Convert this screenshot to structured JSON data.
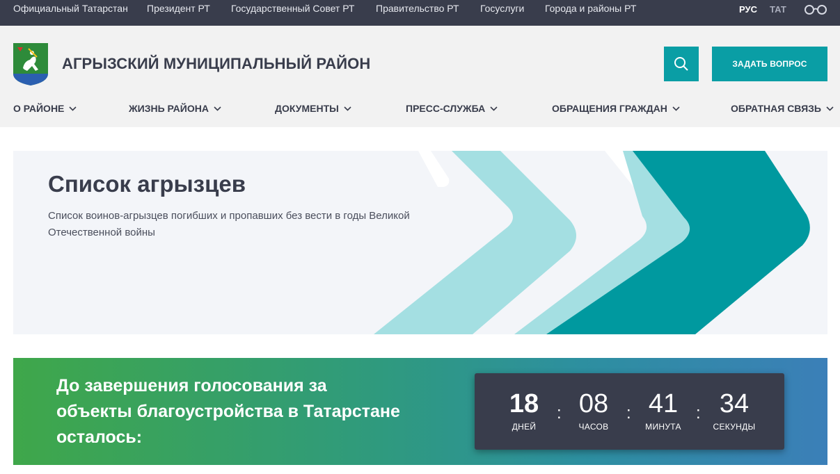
{
  "topbar": {
    "links": [
      "Официальный Татарстан",
      "Президент РТ",
      "Государственный Совет РТ",
      "Правительство РТ",
      "Госуслуги",
      "Города и районы РТ"
    ],
    "lang_ru": "РУС",
    "lang_tat": "ТАТ",
    "accessibility_icon": "glasses-icon"
  },
  "header": {
    "title": "АГРЫЗСКИЙ МУНИЦИПАЛЬНЫЙ РАЙОН",
    "ask_button": "ЗАДАТЬ ВОПРОС",
    "search_icon": "search-icon"
  },
  "nav": {
    "items": [
      "О РАЙОНЕ",
      "ЖИЗНЬ РАЙОНА",
      "ДОКУМЕНТЫ",
      "ПРЕСС-СЛУЖБА",
      "ОБРАЩЕНИЯ ГРАЖДАН",
      "ОБРАТНАЯ СВЯЗЬ"
    ]
  },
  "hero": {
    "title": "Список агрызцев",
    "description": "Список воинов-агрызцев погибших и пропавших без вести в годы Великой Отечественной войны"
  },
  "vote": {
    "text": "До завершения голосования за объекты благоустройства в Татарстане осталось:",
    "timer": [
      {
        "value": "18",
        "label": "ДНЕЙ"
      },
      {
        "value": "08",
        "label": "ЧАСОВ"
      },
      {
        "value": "41",
        "label": "МИНУТА"
      },
      {
        "value": "34",
        "label": "СЕКУНДЫ"
      }
    ],
    "separator": ":"
  },
  "colors": {
    "accent": "#0a9ea5",
    "dark": "#393d4c",
    "header_bg": "#f2f2f2",
    "hero_bg": "#f3f5f9",
    "light_teal": "#a4dfe2"
  }
}
